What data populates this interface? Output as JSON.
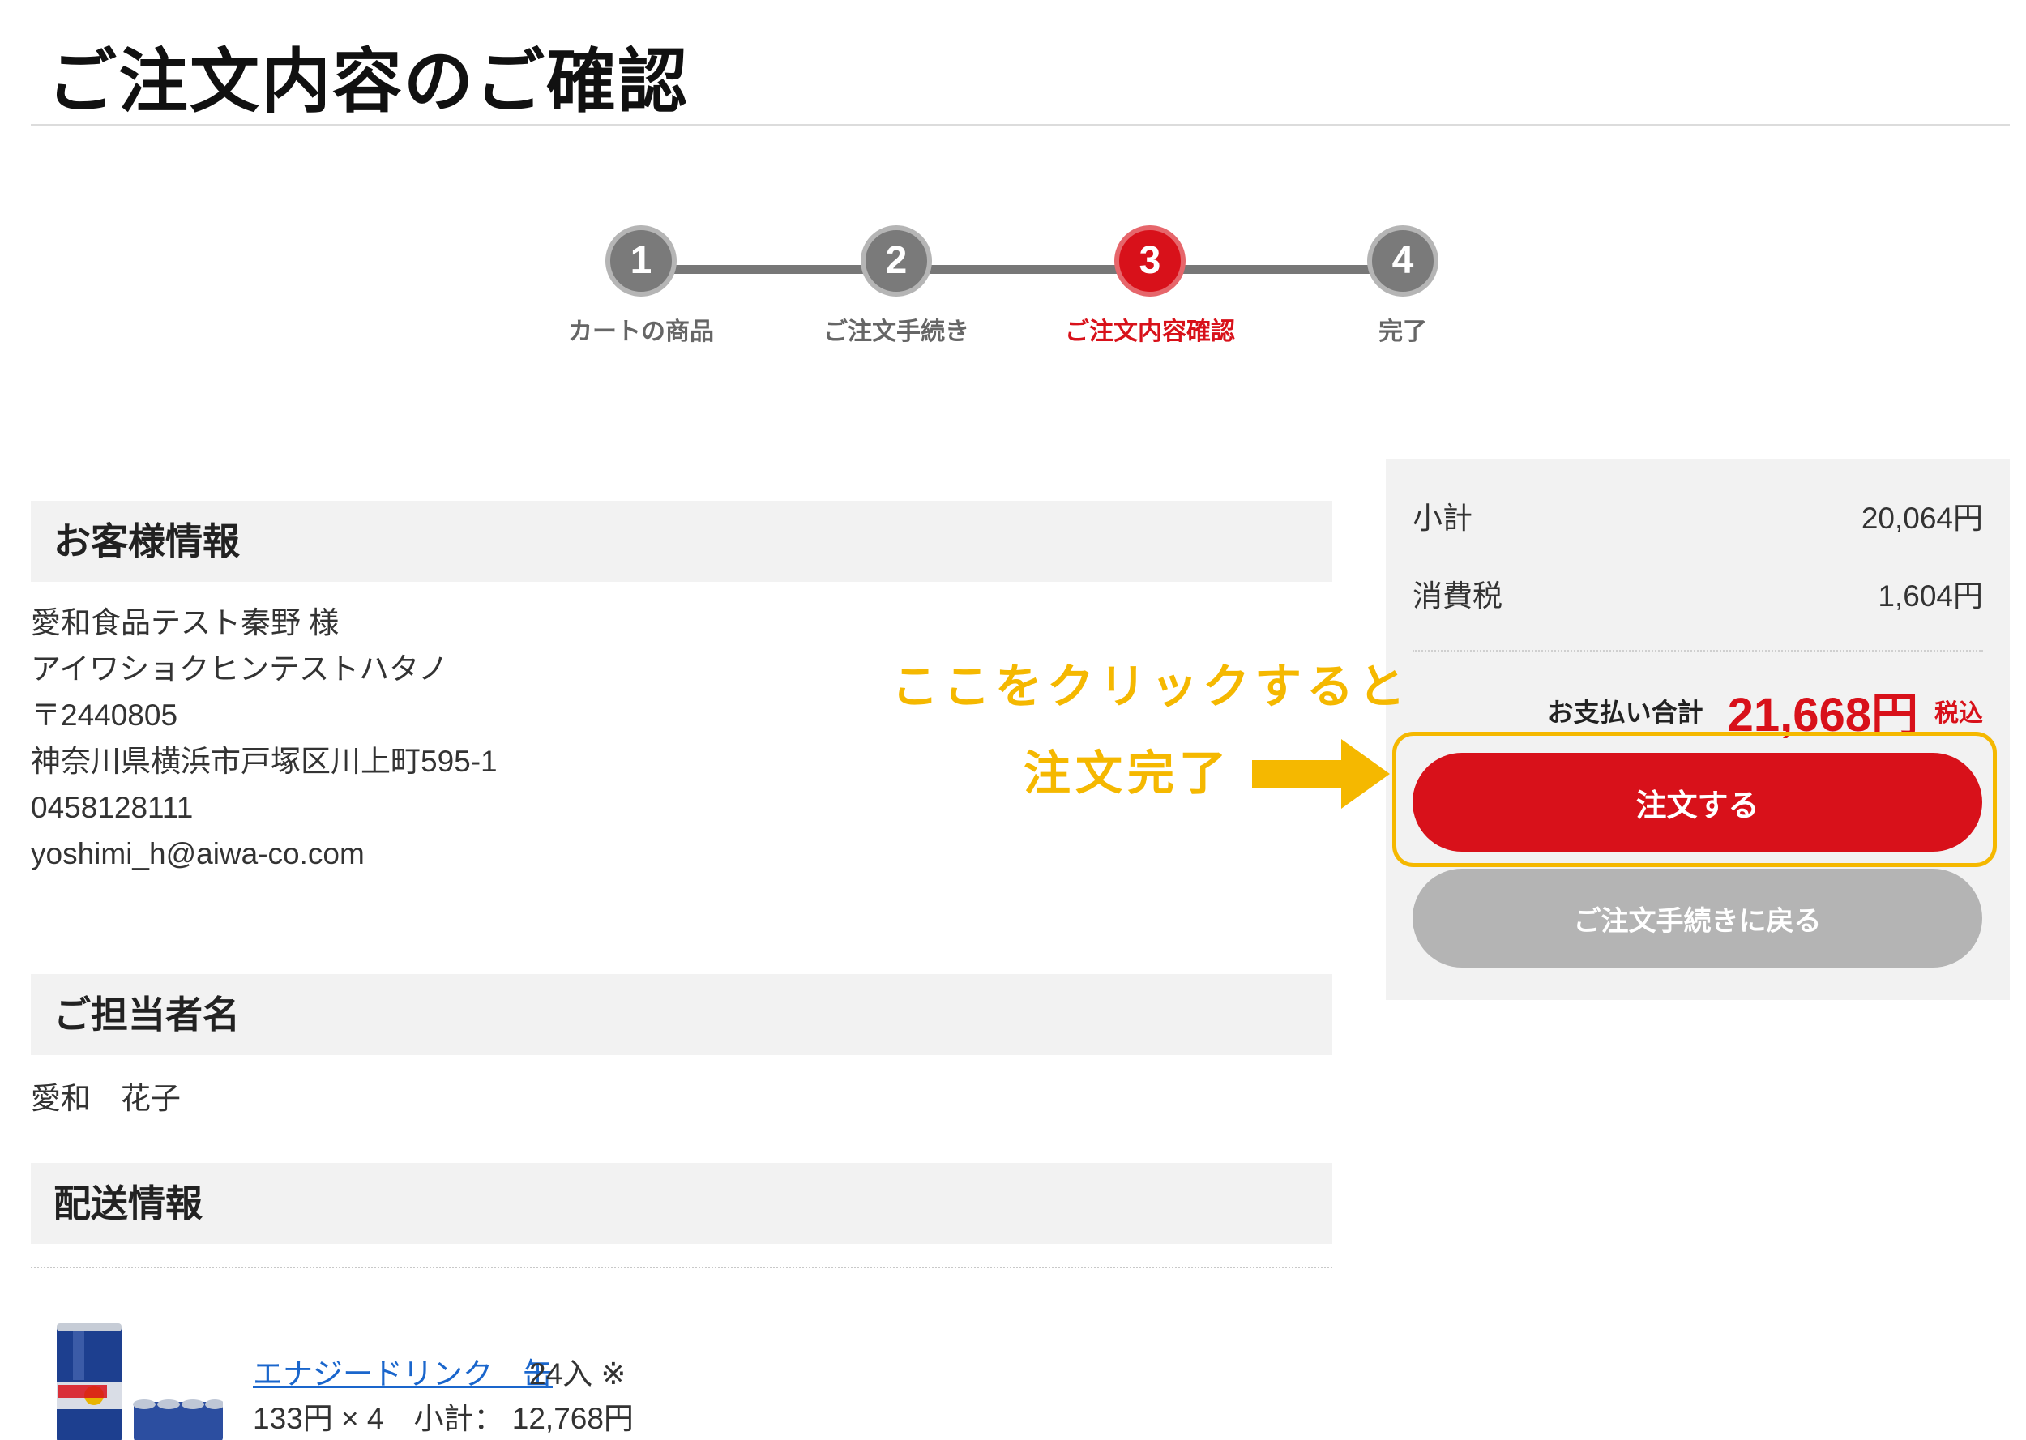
{
  "page": {
    "title": "ご注文内容のご確認"
  },
  "stepper": {
    "steps": [
      {
        "number": "1",
        "label": "カートの商品"
      },
      {
        "number": "2",
        "label": "ご注文手続き"
      },
      {
        "number": "3",
        "label": "ご注文内容確認"
      },
      {
        "number": "4",
        "label": "完了"
      }
    ],
    "active_step": 3
  },
  "customer": {
    "header": "お客様情報",
    "lines": [
      "愛和食品テスト秦野 様",
      "アイワショクヒンテストハタノ",
      "〒2440805",
      "神奈川県横浜市戸塚区川上町595-1",
      "0458128111",
      "yoshimi_h@aiwa-co.com"
    ]
  },
  "contact": {
    "header": "ご担当者名",
    "name": "愛和　花子"
  },
  "shipping": {
    "header": "配送情報",
    "items": [
      {
        "name": "エナジードリンク　缶",
        "quantity_note": "24入 ※",
        "price_line": "133円 × 4　小計： 12,768円",
        "image": "energy-drink-cans"
      }
    ]
  },
  "summary": {
    "subtotal_label": "小計",
    "subtotal_value": "20,064円",
    "tax_label": "消費税",
    "tax_value": "1,604円",
    "total_label": "お支払い合計",
    "total_value": "21,668円",
    "total_tax_note": "税込",
    "order_button": "注文する",
    "back_button": "ご注文手続きに戻る"
  },
  "annotation": {
    "line1": "ここをクリックすると",
    "line2": "注文完了"
  },
  "colors": {
    "accent_red": "#d8111a",
    "annotation_yellow": "#f5b800",
    "step_gray": "#7a7a7a",
    "panel_gray": "#f2f2f2",
    "link_blue": "#1a66cc"
  }
}
